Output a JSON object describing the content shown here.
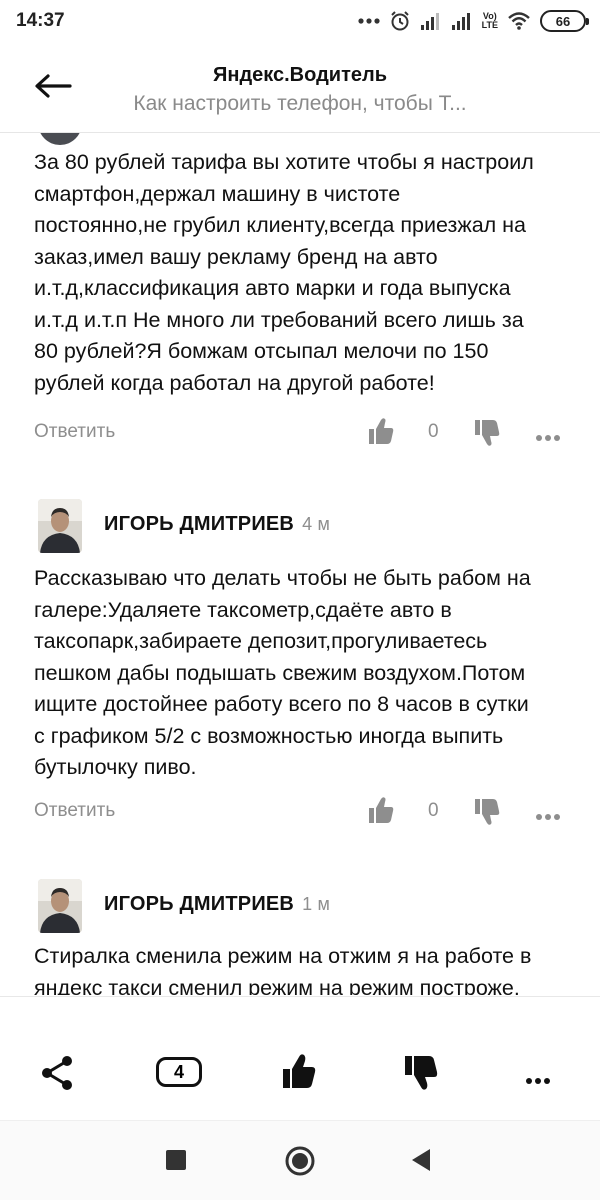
{
  "status_bar": {
    "time": "14:37",
    "battery": "66",
    "lte_label_top": "Vo)",
    "lte_label_bottom": "LTE",
    "icons": [
      "more-dots-icon",
      "alarm-icon",
      "signal-icon",
      "signal-icon",
      "lte-icon",
      "wifi-icon",
      "battery-icon"
    ]
  },
  "header": {
    "back_icon": "arrow-left-icon",
    "title": "Яндекс.Водитель",
    "subtitle": "Как настроить телефон, чтобы Т..."
  },
  "comments": [
    {
      "text_lines": [
        "За 80 рублей тарифа вы хотите чтобы я настроил",
        "смартфон,держал машину в чистоте",
        "постоянно,не грубил клиенту,всегда приезжал на",
        "заказ,имел вашу рекламу бренд на авто",
        "и.т.д,классификация авто марки и года выпуска",
        "и.т.д и.т.п Не много ли требований всего лишь за",
        "80 рублей?Я бомжам отсыпал мелочи по 150",
        "рублей когда работал на другой работе!"
      ],
      "reply_label": "Ответить",
      "likes": "0"
    },
    {
      "author": "ИГОРЬ ДМИТРИЕВ",
      "time": "4 м",
      "text_lines": [
        "Рассказываю что делать чтобы не быть рабом на",
        "галере:Удаляете таксометр,сдаёте авто в",
        "таксопарк,забираете депозит,прогуливаетесь",
        "пешком дабы подышать свежим воздухом.Потом",
        "ищите достойнее работу всего по 8 часов в сутки",
        "с графиком 5/2 с возможностью иногда выпить",
        "бутылочку пиво."
      ],
      "reply_label": "Ответить",
      "likes": "0"
    },
    {
      "author": "ИГОРЬ ДМИТРИЕВ",
      "time": "1 м",
      "text_lines": [
        "Стиралка сменила режим на отжим я на работе в",
        "яндекс такси сменил режим на режим построже."
      ]
    }
  ],
  "toolbar": {
    "comments_count": "4",
    "icons": [
      "share-icon",
      "comments-icon",
      "like-icon",
      "dislike-icon",
      "more-icon"
    ]
  },
  "navbar": {
    "icons": [
      "recent-apps-icon",
      "home-icon",
      "back-icon"
    ]
  },
  "colors": {
    "text": "#111111",
    "muted": "#8e8e8e",
    "subtitle": "#8a8a8a"
  }
}
